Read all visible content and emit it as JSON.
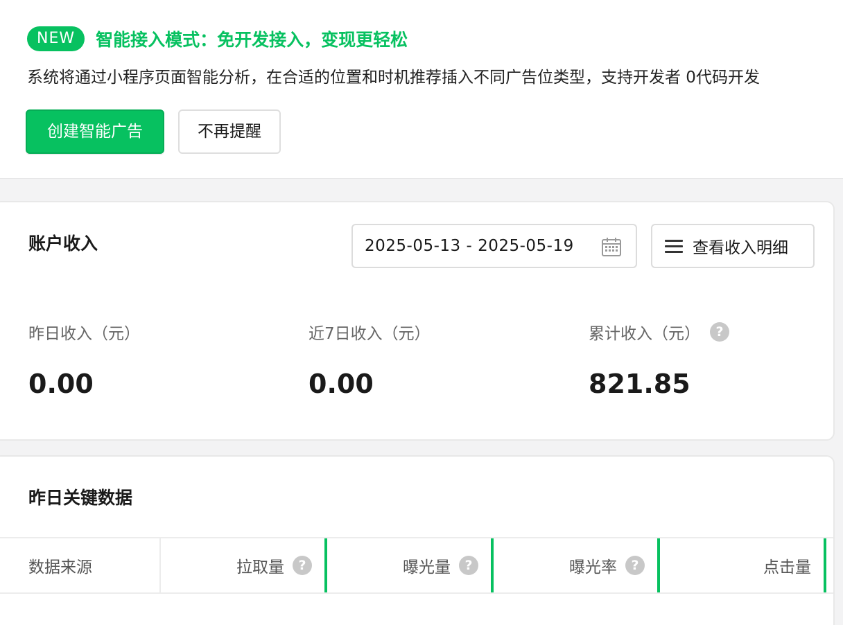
{
  "banner": {
    "badge": "NEW",
    "title": "智能接入模式：免开发接入，变现更轻松",
    "description": "系统将通过小程序页面智能分析，在合适的位置和时机推荐插入不同广告位类型，支持开发者 0代码开发",
    "create_button": "创建智能广告",
    "dismiss_button": "不再提醒"
  },
  "income_card": {
    "title": "账户收入",
    "date_range": "2025-05-13 - 2025-05-19",
    "detail_button": "查看收入明细",
    "metrics": [
      {
        "label": "昨日收入（元）",
        "value": "0.00"
      },
      {
        "label": "近7日收入（元）",
        "value": "0.00"
      },
      {
        "label": "累计收入（元）",
        "value": "821.85"
      }
    ]
  },
  "key_data_card": {
    "title": "昨日关键数据",
    "columns": [
      "数据来源",
      "拉取量",
      "曝光量",
      "曝光率",
      "点击量"
    ]
  },
  "icons": {
    "help": "question-circle-icon",
    "calendar": "calendar-icon",
    "list": "list-icon"
  },
  "colors": {
    "brand_green": "#07c160",
    "text": "#1a1a1a",
    "muted": "#666666"
  }
}
